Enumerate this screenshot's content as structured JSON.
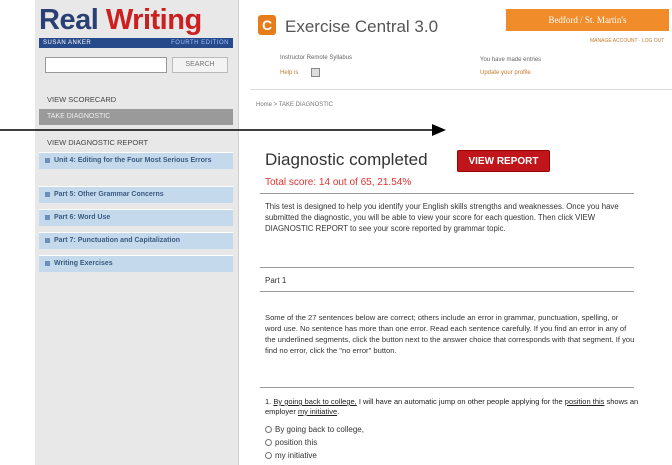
{
  "sidebar": {
    "logo": {
      "word1": "Real",
      "word2": "Writing"
    },
    "byline": {
      "author": "SUSAN ANKER",
      "edition": "FOURTH EDITION"
    },
    "search": {
      "placeholder": "",
      "button": "SEARCH"
    },
    "nav": {
      "scorecard": "VIEW SCORECARD",
      "take_diagnostic": "TAKE DIAGNOSTIC",
      "diagnostic_report": "VIEW DIAGNOSTIC REPORT"
    },
    "units": [
      "Unit 4: Editing for the Four Most Serious Errors",
      "Part 5: Other Grammar Concerns",
      "Part 6: Word Use",
      "Part 7: Punctuation and Capitalization",
      "Writing Exercises"
    ]
  },
  "header": {
    "app_icon": "C",
    "app_title": "Exercise Central 3.0",
    "publisher": "Bedford / St. Martin's",
    "account_links": "MANAGE ACCOUNT · LOG OUT",
    "syllabus_label": "Instructor Remote Syllabus",
    "syllabus_link": "Help is",
    "profile_label": "You have made entries",
    "profile_link": "Update your profile"
  },
  "breadcrumb": "Home > TAKE DIAGNOSTIC",
  "main": {
    "heading_prefix": "Diagnostic",
    "heading_status": "completed",
    "view_report_button": "VIEW REPORT",
    "total_score": "Total score: 14 out of 65, 21.54%",
    "intro": "This test is designed to help you identify your English skills strengths and weaknesses. Once you have submitted the diagnostic, you will be able to view your score for each question. Then click VIEW DIAGNOSTIC REPORT to see your score reported by grammar topic.",
    "part_label": "Part 1",
    "instructions": "Some of the 27 sentences below are correct; others include an error in grammar, punctuation, spelling, or word use. No sentence has more than one error. Read each sentence carefully. If you find an error in any of the underlined segments, click the button next to the answer choice that corresponds with that segment. If you find no error, click the \"no error\" button.",
    "question": {
      "number": "1.",
      "seg1": "By going back to college,",
      "mid1": " I will have an automatic jump on other people applying for the ",
      "seg2": "position this",
      "mid2": " shows an employer ",
      "seg3": "my initiative",
      "end": "."
    },
    "answers": [
      "By going back to college,",
      "position this",
      "my initiative"
    ]
  },
  "colors": {
    "brand_red": "#cc2020",
    "publisher_orange": "#f08c2a",
    "button_red": "#c0161b",
    "nav_blue": "#c5d9ec"
  }
}
